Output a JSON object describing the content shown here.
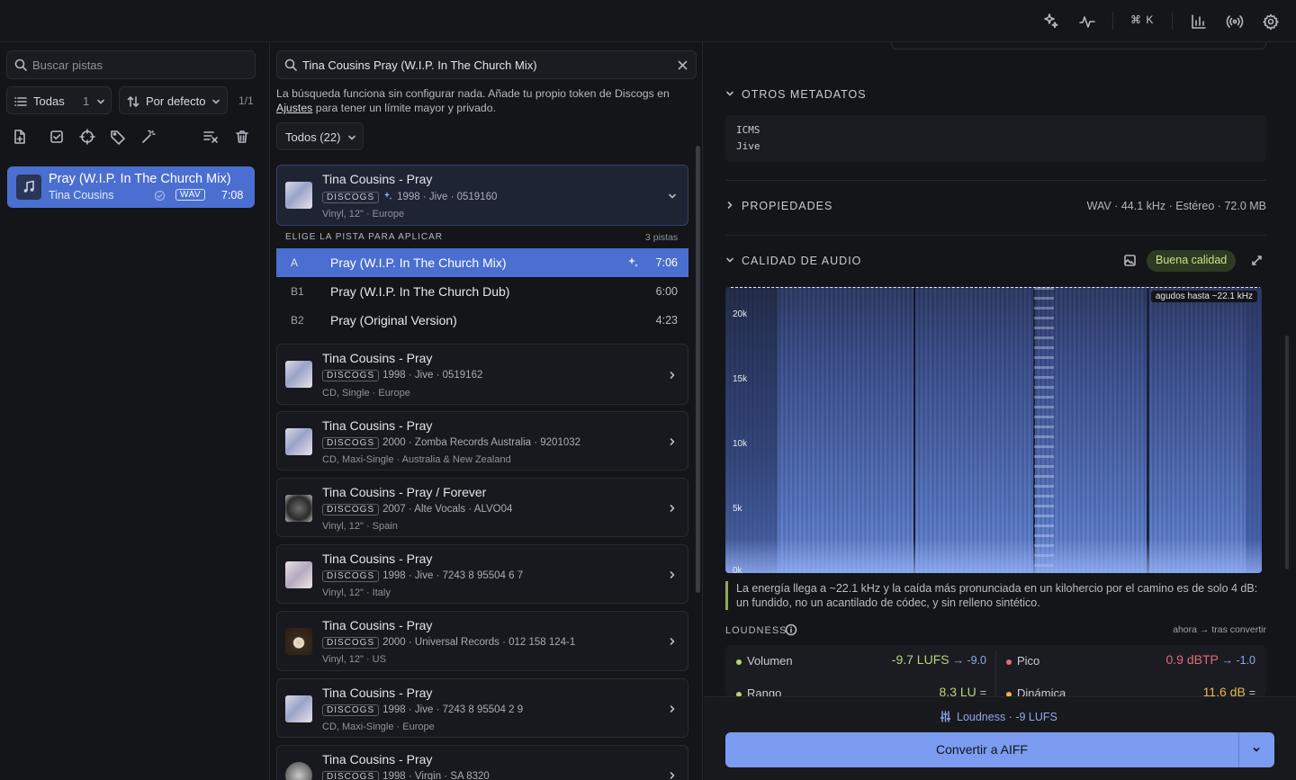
{
  "topbar": {
    "shortcut": "⌘ K"
  },
  "left": {
    "search_placeholder": "Buscar pistas",
    "filter_label": "Todas",
    "filter_count": "1",
    "sort_label": "Por defecto",
    "page_count": "1/1",
    "track": {
      "title": "Pray (W.I.P. In The Church Mix)",
      "artist": "Tina Cousins",
      "format": "WAV",
      "duration": "7:08"
    }
  },
  "mid": {
    "search_value": "Tina Cousins Pray (W.I.P. In The Church Mix)",
    "notice_pre": "La búsqueda funciona sin configurar nada. Añade tu propio token de Discogs en ",
    "notice_link": "Ajustes",
    "notice_post": " para tener un límite mayor y privado.",
    "filter_label": "Todos (22)",
    "source_label": "DISCOGS",
    "expanded": {
      "title": "Tina Cousins - Pray",
      "meta": "1998 · Jive · 0519160",
      "sub": "Vinyl, 12\" · Europe",
      "picker_label": "ELIGE LA PISTA PARA APLICAR",
      "picker_count": "3 pistas",
      "tracks": [
        {
          "pos": "A",
          "title": "Pray (W.I.P. In The Church Mix)",
          "duration": "7:06"
        },
        {
          "pos": "B1",
          "title": "Pray (W.I.P. In The Church Dub)",
          "duration": "6:00"
        },
        {
          "pos": "B2",
          "title": "Pray (Original Version)",
          "duration": "4:23"
        }
      ]
    },
    "results": [
      {
        "title": "Tina Cousins - Pray",
        "meta": "1998 · Jive · 0519162",
        "sub": "CD, Single · Europe"
      },
      {
        "title": "Tina Cousins - Pray",
        "meta": "2000 · Zomba Records Australia · 9201032",
        "sub": "CD, Maxi-Single · Australia & New Zealand"
      },
      {
        "title": "Tina Cousins - Pray / Forever",
        "meta": "2007 · Alte Vocals · ALVO04",
        "sub": "Vinyl, 12\" · Spain"
      },
      {
        "title": "Tina Cousins - Pray",
        "meta": "1998 · Jive · 7243 8 95504 6 7",
        "sub": "Vinyl, 12\" · Italy"
      },
      {
        "title": "Tina Cousins - Pray",
        "meta": "2000 · Universal Records · 012 158 124-1",
        "sub": "Vinyl, 12\" · US"
      },
      {
        "title": "Tina Cousins - Pray",
        "meta": "1998 · Jive · 7243 8 95504 2 9",
        "sub": "CD, Maxi-Single · Europe"
      },
      {
        "title": "Tina Cousins - Pray",
        "meta": "1998 · Virgin · SA 8320",
        "sub": ""
      }
    ]
  },
  "right": {
    "other_meta_heading": "OTROS METADATOS",
    "other_meta_key": "ICMS",
    "other_meta_value": "Jive",
    "props_heading": "PROPIEDADES",
    "props_value": "WAV · 44.1 kHz · Estéreo · 72.0 MB",
    "quality_heading": "CALIDAD DE AUDIO",
    "quality_badge": "Buena calidad",
    "spectrogram": {
      "cutoff_label": "agudos hasta ~22.1 kHz",
      "y_labels": [
        "20k",
        "15k",
        "10k",
        "5k",
        "0k"
      ]
    },
    "analysis": "La energía llega a ~22.1 kHz y la caída más pronunciada en un kilohercio por el camino es de solo 4 dB: un fundido, no un acantilado de códec, y sin relleno sintético.",
    "loudness_heading": "LOUDNESS",
    "loudness_note": "ahora → tras convertir",
    "metrics": [
      {
        "label": "Volumen",
        "value": "-9.7 LUFS",
        "target": "→ -9.0",
        "color": "#b7d37a"
      },
      {
        "label": "Pico",
        "value": "0.9 dBTP",
        "target": "→ -1.0",
        "color": "#e06c7a"
      },
      {
        "label": "Rango",
        "value": "8.3 LU",
        "target": "=",
        "color": "#b7d37a"
      },
      {
        "label": "Dinámica",
        "value": "11.6 dB",
        "target": "=",
        "color": "#e8b64c"
      }
    ],
    "loudness_button": "Loudness · -9 LUFS",
    "convert_button": "Convertir a AIFF"
  },
  "colors": {
    "accent": "#4a6fd1",
    "button": "#7b9cf0",
    "badge_bg": "#2f3a22",
    "badge_fg": "#c6e08a"
  }
}
